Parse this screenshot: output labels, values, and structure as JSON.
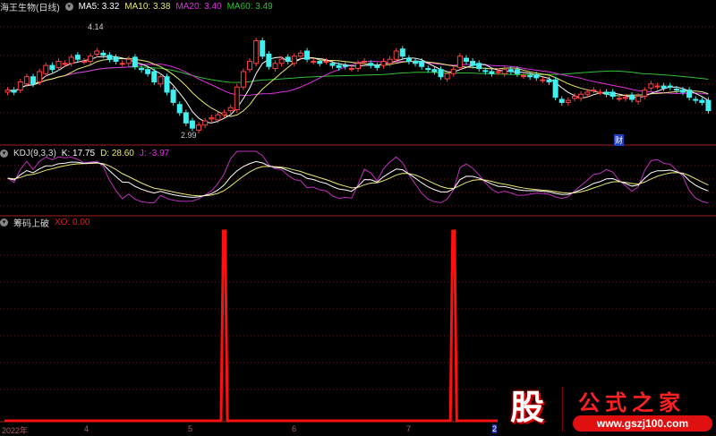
{
  "title": "海王生物(日线)",
  "ma_legend": [
    {
      "label": "MA5: 3.32",
      "color": "#ffffff"
    },
    {
      "label": "MA10: 3.38",
      "color": "#e8e870"
    },
    {
      "label": "MA20: 3.40",
      "color": "#e030e0"
    },
    {
      "label": "MA60: 3.49",
      "color": "#30c030"
    }
  ],
  "kdj_legend": {
    "name": "KDJ(9,3,3)",
    "k": "K: 17.75",
    "d": "D: 28.60",
    "j": "J: -3.97"
  },
  "xo_legend": {
    "name": "筹码上破",
    "xo": "XO: 0.00"
  },
  "annotations": {
    "high": "4.14",
    "low": "2.99",
    "badge": "财"
  },
  "axis_labels": [
    "2022年",
    "4",
    "5",
    "6",
    "7",
    "2"
  ],
  "logo": {
    "char": "股",
    "name": "公式之家",
    "url": "www.gszj100.com"
  },
  "chart_data": {
    "type": "candlestick",
    "price_range": [
      2.99,
      4.14
    ],
    "closes": [
      3.42,
      3.4,
      3.5,
      3.55,
      3.48,
      3.6,
      3.66,
      3.62,
      3.7,
      3.68,
      3.74,
      3.72,
      3.7,
      3.75,
      3.8,
      3.76,
      3.72,
      3.7,
      3.68,
      3.72,
      3.65,
      3.62,
      3.58,
      3.5,
      3.55,
      3.4,
      3.3,
      3.2,
      3.1,
      3.05,
      3.08,
      3.12,
      3.15,
      3.18,
      3.2,
      3.25,
      3.45,
      3.6,
      3.7,
      3.9,
      3.75,
      3.65,
      3.68,
      3.72,
      3.7,
      3.75,
      3.78,
      3.72,
      3.7,
      3.68,
      3.7,
      3.66,
      3.64,
      3.65,
      3.63,
      3.68,
      3.7,
      3.66,
      3.64,
      3.7,
      3.72,
      3.8,
      3.75,
      3.7,
      3.68,
      3.65,
      3.62,
      3.6,
      3.55,
      3.58,
      3.62,
      3.75,
      3.7,
      3.66,
      3.63,
      3.6,
      3.58,
      3.6,
      3.62,
      3.6,
      3.58,
      3.56,
      3.55,
      3.54,
      3.52,
      3.5,
      3.35,
      3.3,
      3.32,
      3.36,
      3.38,
      3.4,
      3.42,
      3.4,
      3.38,
      3.36,
      3.34,
      3.35,
      3.33,
      3.36,
      3.42,
      3.48,
      3.46,
      3.44,
      3.45,
      3.42,
      3.4,
      3.35,
      3.32,
      3.3,
      3.22
    ],
    "xo_spikes": [
      34,
      70
    ],
    "xo_range": [
      0,
      1
    ]
  }
}
